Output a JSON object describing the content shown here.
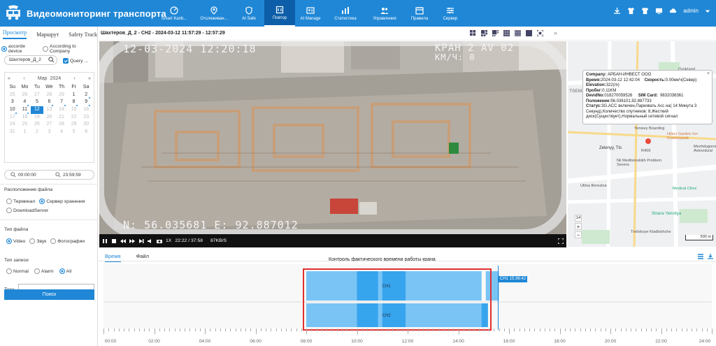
{
  "app": {
    "title": "Видеомониторинг транспорта"
  },
  "nav": [
    {
      "label": "Smart Kanb...",
      "icon": "dashboard-icon"
    },
    {
      "label": "Отслеживан...",
      "icon": "location-pin-icon"
    },
    {
      "label": "AI Safe",
      "icon": "shield-icon"
    },
    {
      "label": "Повтор",
      "icon": "playback-icon",
      "active": true
    },
    {
      "label": "AI Manage",
      "icon": "id-card-icon"
    },
    {
      "label": "Статистика",
      "icon": "bar-chart-icon"
    },
    {
      "label": "Управления",
      "icon": "users-icon"
    },
    {
      "label": "Правила",
      "icon": "calendar-icon"
    },
    {
      "label": "Сервер",
      "icon": "sliders-icon"
    }
  ],
  "topright": {
    "user": "admin"
  },
  "sidebar": {
    "tabs": [
      "Просмотр",
      "Маршрут",
      "Safety Track"
    ],
    "mode_options": [
      "accorde device",
      "According to Company"
    ],
    "vehicle_value": "Шахтеров_Д_2",
    "query_label": "Query ...",
    "calendar": {
      "month": "Мар",
      "year": "2024",
      "weekdays": [
        "Su",
        "Mo",
        "Tu",
        "We",
        "Th",
        "Fr",
        "Sa"
      ],
      "days": [
        [
          "25",
          "26",
          "27",
          "28",
          "29",
          "1",
          "2"
        ],
        [
          "3",
          "4",
          "5",
          "6",
          "7",
          "8",
          "9"
        ],
        [
          "10",
          "11",
          "12",
          "13",
          "14",
          "15",
          "16"
        ],
        [
          "17",
          "18",
          "19",
          "20",
          "21",
          "22",
          "23"
        ],
        [
          "24",
          "25",
          "26",
          "27",
          "28",
          "29",
          "30"
        ],
        [
          "31",
          "1",
          "2",
          "3",
          "4",
          "5",
          "6"
        ]
      ],
      "selected": "12"
    },
    "time_start": "00:00:00",
    "time_end": "23:59:59",
    "file_location_label": "Расположение файла",
    "file_location": [
      "Терминал",
      "Сервер хранения",
      "DownloadServer"
    ],
    "file_type_label": "Тип файла",
    "file_type": [
      "Video",
      "Звук",
      "Фотографии"
    ],
    "record_type_label": "Тип записи",
    "record_type": [
      "Normal",
      "Alarm",
      "All"
    ],
    "tags_label": "Теги:",
    "search_button": "Поиск"
  },
  "player": {
    "title": "Шахтеров_Д_2 - CH2 - 2024-03-12 11:57:29 - 12:57:29",
    "osd_datetime": "12-03-2024 12:20:18",
    "osd_vehicle": "КРАН 2 AV 02",
    "osd_speed": "KM/Ч: 0",
    "osd_coords": "N: 56.035681 E: 92.887012",
    "speed": "1X",
    "progress": "22:22 / 37:58",
    "bitrate": "87KB/S"
  },
  "popup": {
    "company_label": "Company:",
    "company": "АРБАН-ИНВЕСТ ООО",
    "time_label": "Время:",
    "time": "2024-03-12 12:42:04",
    "speed_label": "Скорость:",
    "speed": "0.00км/ч(Север)",
    "elevation_label": "Elevation:",
    "elevation": "322(m)",
    "mileage_label": "Пробег:",
    "mileage": "0.11KM",
    "devid_label": "DevidNo:",
    "devid": "018270059526",
    "sim_label": "SIM Card:",
    "sim": "9832038361",
    "position_label": "Положение:",
    "position": "56.036101,92.887733",
    "status_label": "Статус:",
    "status": "3G,ACC включен,Парковать Acc на( 14 Минута 3 Секунд),Количество спутников: 8,Жесткий диск(Существует),Нормальный сетевой сигнал"
  },
  "map": {
    "labels": [
      "Grokland",
      "Hilton Garden Inn Krasnoyarsk",
      "Zelenyy, Tts",
      "Nii Meditsinskikh Problem Severa",
      "Ulitsa Berezina",
      "Strana Yenotiya",
      "Troitskoye Kladbishche",
      "Mezhdugorodnyy Avtovokzal",
      "TSEMZ",
      "Yenisey Boarding",
      "Medical Clinic",
      "R409"
    ],
    "zoom": "14",
    "scale": "500 m"
  },
  "bottom": {
    "tabs": [
      "Время",
      "Файл"
    ],
    "chart_title": "Контроль фактического времени работы крана",
    "channel_tag": "CH1 15:36:42",
    "channels": [
      "CH1",
      "CH2"
    ],
    "ticks": [
      "00:00",
      "02:00",
      "04:00",
      "06:00",
      "08:00",
      "10:00",
      "12:00",
      "14:00",
      "16:00",
      "18:00",
      "20:00",
      "22:00",
      "24:00"
    ]
  },
  "chart_data": {
    "type": "timeline",
    "title": "Контроль фактического времени работы крана",
    "x_range": [
      "00:00",
      "24:00"
    ],
    "series": [
      {
        "name": "CH1",
        "recorded_segments": [
          [
            "08:00",
            "14:55"
          ],
          [
            "15:05",
            "15:36"
          ]
        ],
        "dense_segments": [
          [
            "10:00",
            "10:50"
          ],
          [
            "11:00",
            "11:55"
          ]
        ]
      },
      {
        "name": "CH2",
        "recorded_segments": [
          [
            "08:00",
            "15:10"
          ]
        ],
        "dense_segments": [
          [
            "10:00",
            "10:50"
          ],
          [
            "11:00",
            "11:55"
          ],
          [
            "14:55",
            "15:10"
          ]
        ]
      }
    ],
    "cursor": "15:36:42"
  }
}
